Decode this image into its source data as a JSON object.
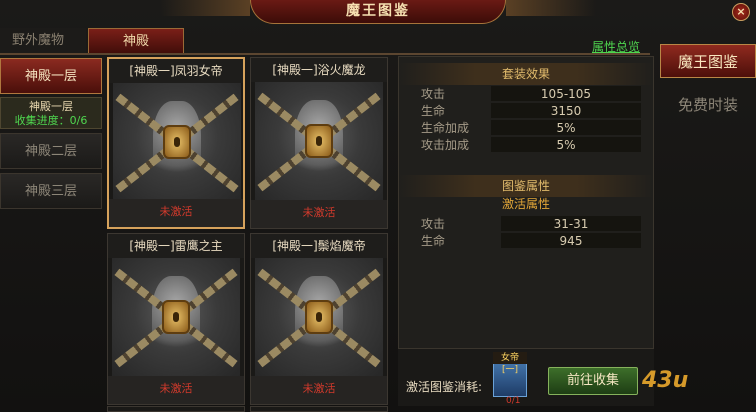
{
  "window": {
    "title": "魔王图鉴",
    "close_label": "×"
  },
  "tabs": [
    {
      "label": "野外魔物",
      "active": false
    },
    {
      "label": "神殿",
      "active": true
    }
  ],
  "attr_overview_label": "属性总览",
  "sidebar": {
    "floors": [
      {
        "label": "神殿一层",
        "active": true
      },
      {
        "label": "神殿二层",
        "active": false
      },
      {
        "label": "神殿三层",
        "active": false
      }
    ],
    "progress": {
      "floor": "神殿一层",
      "text": "收集进度：0/6"
    }
  },
  "cards": [
    {
      "name": "[神殿一]凤羽女帝",
      "status": "未激活",
      "selected": true
    },
    {
      "name": "[神殿一]浴火魔龙",
      "status": "未激活",
      "selected": false
    },
    {
      "name": "[神殿一]雷鹰之主",
      "status": "未激活",
      "selected": false
    },
    {
      "name": "[神殿一]鬃焰魔帝",
      "status": "未激活",
      "selected": false
    }
  ],
  "panel": {
    "set_effect": {
      "title": "套装效果",
      "rows": [
        {
          "key": "攻击",
          "value": "105-105"
        },
        {
          "key": "生命",
          "value": "3150"
        },
        {
          "key": "生命加成",
          "value": "5%"
        },
        {
          "key": "攻击加成",
          "value": "5%"
        }
      ]
    },
    "card_attrs": {
      "title": "图鉴属性",
      "subtitle": "激活属性",
      "rows": [
        {
          "key": "攻击",
          "value": "31-31"
        },
        {
          "key": "生命",
          "value": "945"
        }
      ]
    },
    "consume": {
      "label": "激活图鉴消耗:",
      "item_tag": "女帝[一]",
      "item_count": "0/1",
      "goto_label": "前往收集"
    }
  },
  "side_tabs": [
    {
      "label": "魔王图鉴",
      "active": true
    },
    {
      "label": "免费时装",
      "active": false
    }
  ],
  "colors": {
    "accent_red": "#8b2a20",
    "gold": "#d6a25c",
    "status_red": "#d23a2c",
    "link_green": "#4fd64f"
  }
}
